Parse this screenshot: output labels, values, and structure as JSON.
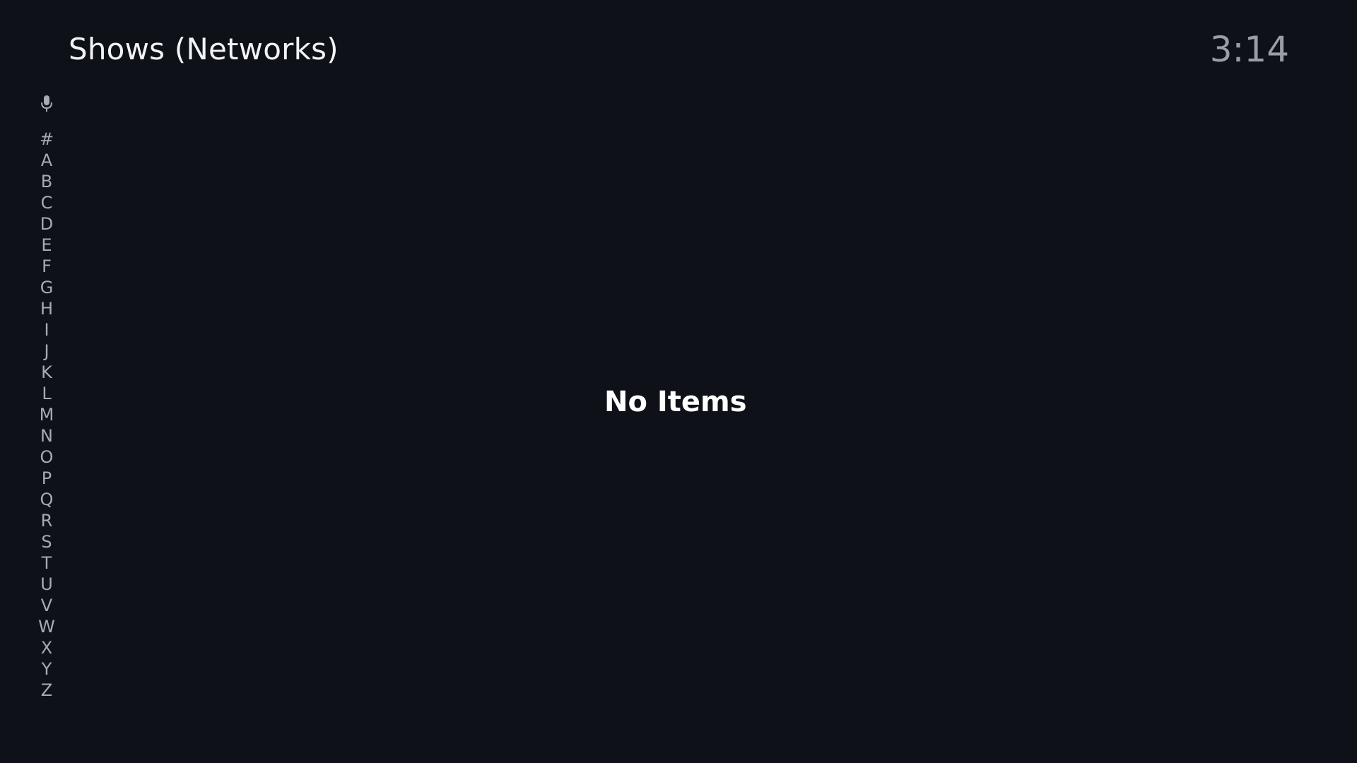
{
  "header": {
    "title": "Shows (Networks)",
    "time": "3:14"
  },
  "alpha_rail": {
    "voice_icon": "microphone-icon",
    "letters": [
      "#",
      "A",
      "B",
      "C",
      "D",
      "E",
      "F",
      "G",
      "H",
      "I",
      "J",
      "K",
      "L",
      "M",
      "N",
      "O",
      "P",
      "Q",
      "R",
      "S",
      "T",
      "U",
      "V",
      "W",
      "X",
      "Y",
      "Z"
    ]
  },
  "main": {
    "empty_message": "No Items"
  },
  "colors": {
    "background": "#0e1118",
    "title_text": "#f2f3f5",
    "clock_text": "#9a9ea6",
    "rail_text": "#a7abb2",
    "empty_text": "#ffffff"
  }
}
